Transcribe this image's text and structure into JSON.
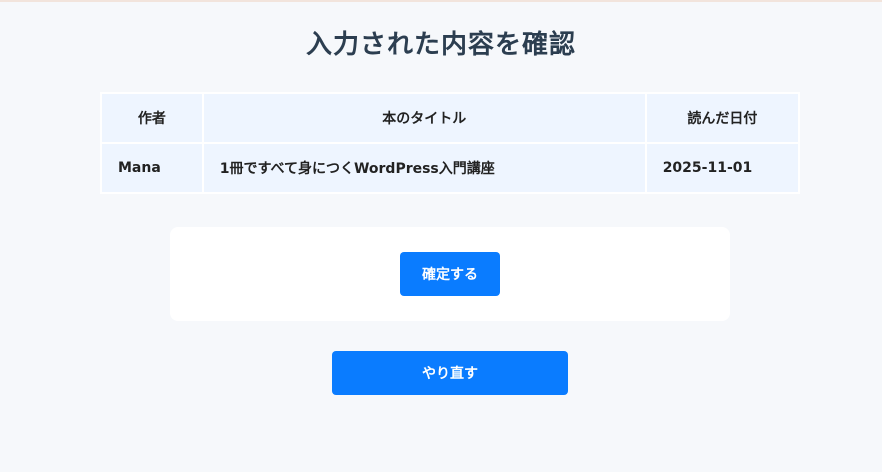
{
  "page": {
    "title": "入力された内容を確認"
  },
  "table": {
    "headers": {
      "author": "作者",
      "title": "本のタイトル",
      "date": "読んだ日付"
    },
    "rows": [
      {
        "author": "Mana",
        "title": "1冊ですべて身につくWordPress入門講座",
        "date": "2025-11-01"
      }
    ]
  },
  "actions": {
    "confirm_label": "確定する",
    "redo_label": "やり直す"
  },
  "colors": {
    "primary": "#0a7cff",
    "background": "#f6f8fb",
    "table_bg": "#eef5ff",
    "title_text": "#2c3e50"
  }
}
